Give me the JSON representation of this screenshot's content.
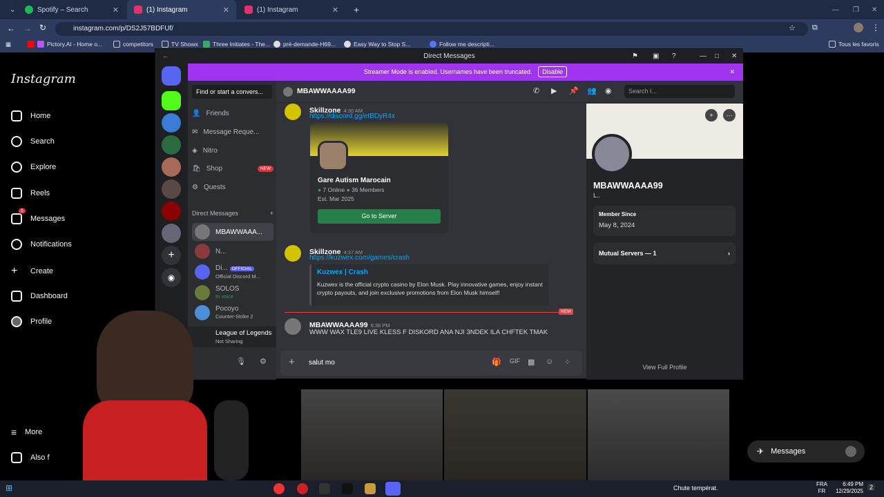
{
  "browser": {
    "tabs": [
      {
        "label": "Spotify – Search",
        "color": "#1db954"
      },
      {
        "label": "(1) Instagram",
        "color": "#e1306c"
      },
      {
        "label": "(1) Instagram",
        "color": "#e1306c"
      }
    ],
    "url": "instagram.com/p/DS2J57BDFUf/",
    "bookmarks": [
      "Pictory.AI - Home o...",
      "competitors",
      "TV Shows",
      "Three Initiates - The...",
      "pré-demande-H69...",
      "Easy Way to Stop S...",
      "Follow me descripti..."
    ],
    "all_bookmarks": "Tous les favoris"
  },
  "instagram": {
    "logo": "Instagram",
    "nav": [
      "Home",
      "Search",
      "Explore",
      "Reels",
      "Messages",
      "Notifications",
      "Create",
      "Dashboard",
      "Profile"
    ],
    "more": "More",
    "also": "Also f",
    "messages_badge": "1",
    "messages_pill": "Messages"
  },
  "discord": {
    "window_title": "Direct Messages",
    "streamer_banner": "Streamer Mode is enabled. Usernames have been truncated.",
    "disable_label": "Disable",
    "find_placeholder": "Find or start a convers...",
    "nav": {
      "friends": "Friends",
      "message_requests": "Message Reque...",
      "nitro": "Nitro",
      "shop": "Shop",
      "shop_badge": "NEW",
      "quests": "Quests"
    },
    "dm_header": "Direct Messages",
    "dms": [
      {
        "name": "MBAWWAAA...",
        "sub": ""
      },
      {
        "name": "N...",
        "sub": ""
      },
      {
        "name": "Di...",
        "badge": "OFFICIAL",
        "sub": "Official Discord M..."
      },
      {
        "name": "SOLOS",
        "sub": "In voice"
      },
      {
        "name": "Pocoyo",
        "sub": "Counter-Strike 2"
      }
    ],
    "activity": {
      "title": "League of Legends",
      "sub": "Not Sharing"
    },
    "chat_header": "MBAWWAAAA99",
    "search_placeholder": "Search I...",
    "messages": [
      {
        "author": "Skillzone",
        "time": "4:30 AM",
        "link": "https://discord.gg/etBDyR4x"
      },
      {
        "author": "Skillzone",
        "time": "4:37 AM",
        "link": "https://kuzwex.com/games/crash"
      },
      {
        "author": "MBAWWAAAA99",
        "time": "6:38 PM",
        "text": "WWW WAX TLE9 LIVE KLESS F DISKORD ANA NJI 3NDEK ILA CHFTEK TMAK"
      }
    ],
    "invite": {
      "name": "Gare Autism Marocain",
      "online": "7 Online",
      "members": "36 Members",
      "est": "Est. Mar 2025",
      "button": "Go to Server"
    },
    "embed": {
      "title": "Kuzwex | Crash",
      "desc": "Kuzwex is the official crypto casino by Elon Musk. Play innovative games, enjoy instant crypto payouts, and join exclusive promotions from Elon Musk himself!"
    },
    "new_label": "NEW",
    "input_value": "salut mo",
    "profile": {
      "name": "MBAWWAAAA99",
      "tag": "L..",
      "member_since_label": "Member Since",
      "member_since": "May 8, 2024",
      "mutual": "Mutual Servers — 1",
      "view_full": "View Full Profile"
    }
  },
  "taskbar": {
    "weather": "Chute températ.",
    "lang1": "FRA",
    "lang2": "FR",
    "time": "6:49 PM",
    "date": "12/29/2025",
    "notif": "2"
  }
}
